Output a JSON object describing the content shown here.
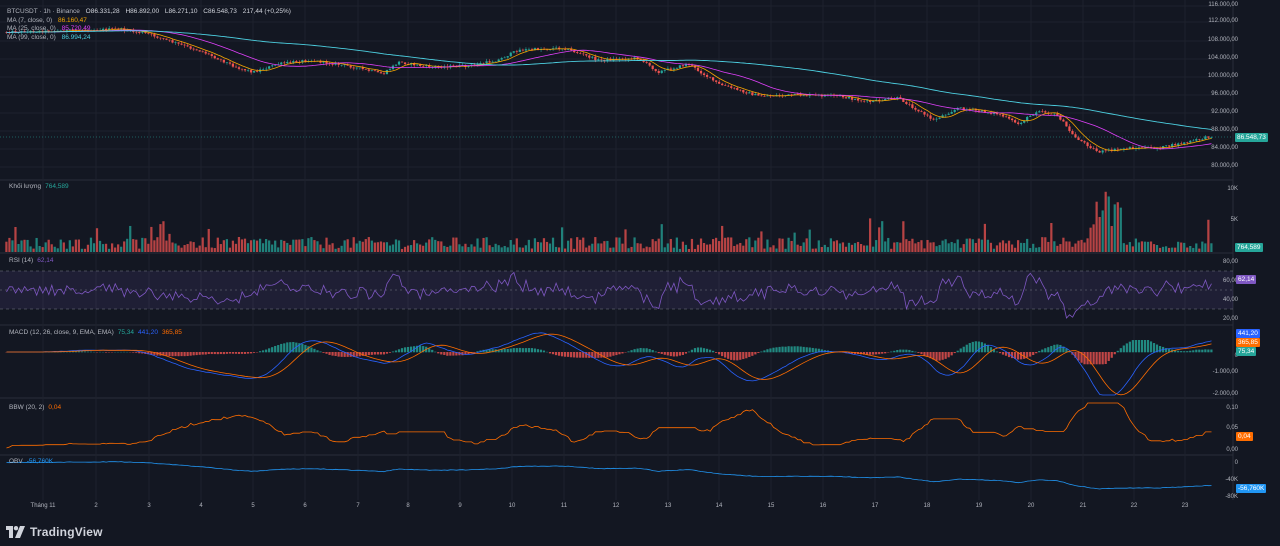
{
  "app": {
    "brand": "TradingView"
  },
  "header": {
    "symbol": "BTCUSDT · 1h · Binance",
    "open": "O86.331,28",
    "high": "H86.892,00",
    "low": "L86.271,10",
    "close": "C86.548,73",
    "change": "217,44 (+0,25%)",
    "ma1_label": "MA (7, close, 0)",
    "ma1_value": "86.160,47",
    "ma2_label": "MA (25, close, 0)",
    "ma2_value": "85.720,49",
    "ma3_label": "MA (99, close, 0)",
    "ma3_value": "86.994,24"
  },
  "price_axis": [
    "116.000,00",
    "112.000,00",
    "108.000,00",
    "104.000,00",
    "100.000,00",
    "96.000,00",
    "92.000,00",
    "88.000,00",
    "84.000,00",
    "80.000,00"
  ],
  "price_tag": "86.548,73",
  "volume": {
    "label": "Khối lượng",
    "value": "764,589",
    "axis": [
      "10K",
      "5K"
    ],
    "tag": "764,589"
  },
  "rsi": {
    "label": "RSI (14)",
    "value": "62,14",
    "axis": [
      "80,00",
      "60,00",
      "40,00",
      "20,00"
    ],
    "tag": "62,14"
  },
  "macd": {
    "label": "MACD (12, 26, close, 9, EMA, EMA)",
    "v1": "75,34",
    "v2": "441,20",
    "v3": "365,85",
    "axis": [
      "0",
      "-1.000,00",
      "-2.000,00"
    ],
    "tag1": "441,20",
    "tag2": "365,85",
    "tag3": "75,34"
  },
  "bbw": {
    "label": "BBW (20, 2)",
    "value": "0,04",
    "axis": [
      "0,10",
      "0,05",
      "0,00"
    ],
    "tag": "0,04"
  },
  "obv": {
    "label": "OBV",
    "value": "-56,760K",
    "axis": [
      "0",
      "-40K",
      "-80K"
    ],
    "tag": "-56,760K"
  },
  "time_axis": [
    "Tháng 11",
    "2",
    "3",
    "4",
    "5",
    "6",
    "7",
    "8",
    "9",
    "10",
    "11",
    "12",
    "13",
    "14",
    "15",
    "16",
    "17",
    "18",
    "19",
    "20",
    "21",
    "22",
    "23"
  ],
  "colors": {
    "background": "#131722",
    "up": "#26a69a",
    "down": "#ef5350",
    "ma7": "#f7a600",
    "ma25": "#e040fb",
    "ma99": "#4dd0e1",
    "rsi": "#7e57c2",
    "macd": "#2962ff",
    "signal": "#ff6d00",
    "bbw": "#ff6d00",
    "obv": "#2196f3"
  }
}
